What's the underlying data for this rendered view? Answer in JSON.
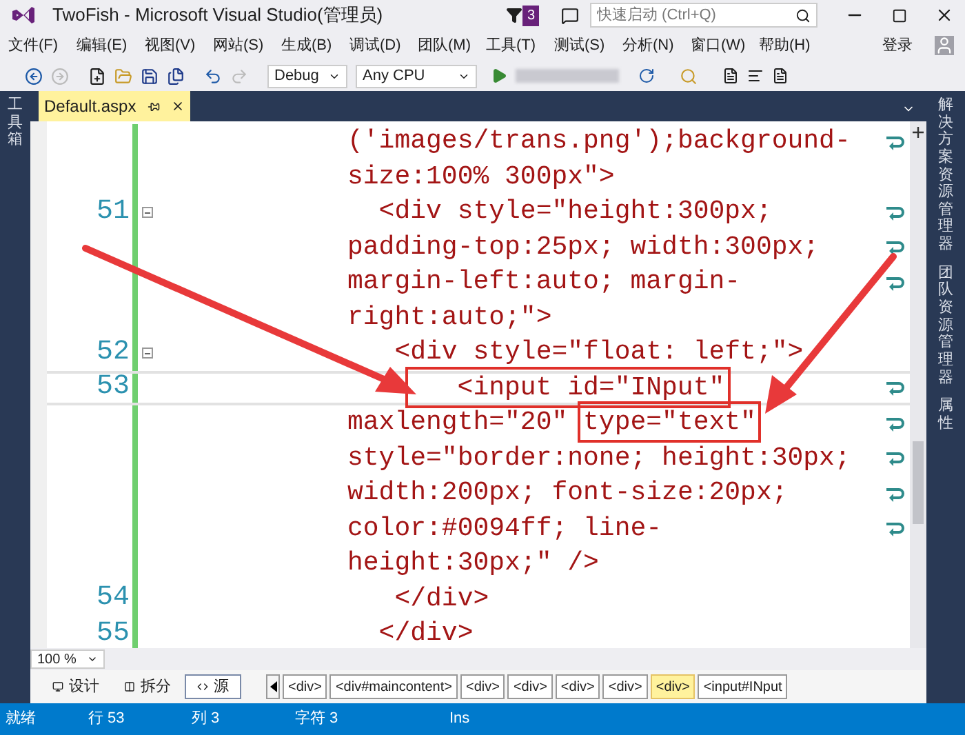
{
  "window": {
    "title": "TwoFish - Microsoft Visual Studio(管理员)",
    "notification_count": "3",
    "quick_launch": {
      "placeholder": "快速启动 (Ctrl+Q)"
    }
  },
  "menu": [
    "文件(F)",
    "编辑(E)",
    "视图(V)",
    "网站(S)",
    "生成(B)",
    "调试(D)",
    "团队(M)",
    "工具(T)",
    "测试(S)",
    "分析(N)",
    "窗口(W)",
    "帮助(H)"
  ],
  "sign_in": "登录",
  "toolbar": {
    "configuration": "Debug",
    "platform": "Any CPU"
  },
  "left_panel": {
    "tabs": [
      "工具箱"
    ]
  },
  "right_panel": {
    "tabs": [
      "解决方案资源管理器",
      "团队资源管理器",
      "属性"
    ]
  },
  "document_tab": {
    "title": "Default.aspx",
    "selected": true
  },
  "editor": {
    "lines": [
      {
        "current": false,
        "wraps": true,
        "fold": false,
        "segments": [
          {
            "text": "('images/trans.png');background-",
            "boxed": false
          }
        ]
      },
      {
        "current": false,
        "wraps": false,
        "fold": false,
        "segments": [
          {
            "text": "size:100% 300px\">",
            "boxed": false
          }
        ]
      },
      {
        "number": "51",
        "current": false,
        "wraps": true,
        "fold": true,
        "segments": [
          {
            "text": "  <div style=\"height:300px;",
            "boxed": false
          }
        ]
      },
      {
        "current": false,
        "wraps": true,
        "fold": false,
        "segments": [
          {
            "text": "padding-top:25px; width:300px;",
            "boxed": false
          }
        ]
      },
      {
        "current": false,
        "wraps": true,
        "fold": false,
        "segments": [
          {
            "text": "margin-left:auto; margin-",
            "boxed": false
          }
        ]
      },
      {
        "current": false,
        "wraps": false,
        "fold": false,
        "segments": [
          {
            "text": "right:auto;\">",
            "boxed": false
          }
        ]
      },
      {
        "number": "52",
        "current": false,
        "wraps": false,
        "fold": true,
        "segments": [
          {
            "text": "   <div style=\"float: left;\">",
            "boxed": false
          }
        ]
      },
      {
        "number": "53",
        "current": true,
        "wraps": true,
        "fold": false,
        "segments": [
          {
            "text": "   <input id=\"INput\"",
            "boxed": true
          }
        ]
      },
      {
        "current": false,
        "wraps": true,
        "fold": false,
        "segments": [
          {
            "text": "maxlength=\"20\" ",
            "boxed": false
          },
          {
            "text": "type=\"text\"",
            "boxed": true
          }
        ]
      },
      {
        "current": false,
        "wraps": true,
        "fold": false,
        "segments": [
          {
            "text": "style=\"border:none; height:30px;",
            "boxed": false
          }
        ]
      },
      {
        "current": false,
        "wraps": true,
        "fold": false,
        "segments": [
          {
            "text": "width:200px; font-size:20px;",
            "boxed": false
          }
        ]
      },
      {
        "current": false,
        "wraps": true,
        "fold": false,
        "segments": [
          {
            "text": "color:#0094ff; line-",
            "boxed": false
          }
        ]
      },
      {
        "current": false,
        "wraps": false,
        "fold": false,
        "segments": [
          {
            "text": "height:30px;\" />",
            "boxed": false
          }
        ]
      },
      {
        "number": "54",
        "current": false,
        "wraps": false,
        "fold": false,
        "segments": [
          {
            "text": "   </div>",
            "boxed": false
          }
        ]
      },
      {
        "number": "55",
        "current": false,
        "wraps": false,
        "fold": false,
        "segments": [
          {
            "text": "  </div>",
            "boxed": false
          }
        ]
      }
    ]
  },
  "zoom": "100 %",
  "view_tabs": [
    {
      "label": "设计",
      "selected": false
    },
    {
      "label": "拆分",
      "selected": false
    },
    {
      "label": "源",
      "selected": true
    }
  ],
  "breadcrumb": [
    {
      "label": "<div>",
      "selected": false
    },
    {
      "label": "<div#maincontent>",
      "selected": false
    },
    {
      "label": "<div>",
      "selected": false
    },
    {
      "label": "<div>",
      "selected": false
    },
    {
      "label": "<div>",
      "selected": false
    },
    {
      "label": "<div>",
      "selected": false
    },
    {
      "label": "<div>",
      "selected": true
    },
    {
      "label": "<input#INput",
      "selected": false
    }
  ],
  "status_bar": [
    "就绪",
    "行 53",
    "列 3",
    "字符 3",
    "Ins"
  ]
}
